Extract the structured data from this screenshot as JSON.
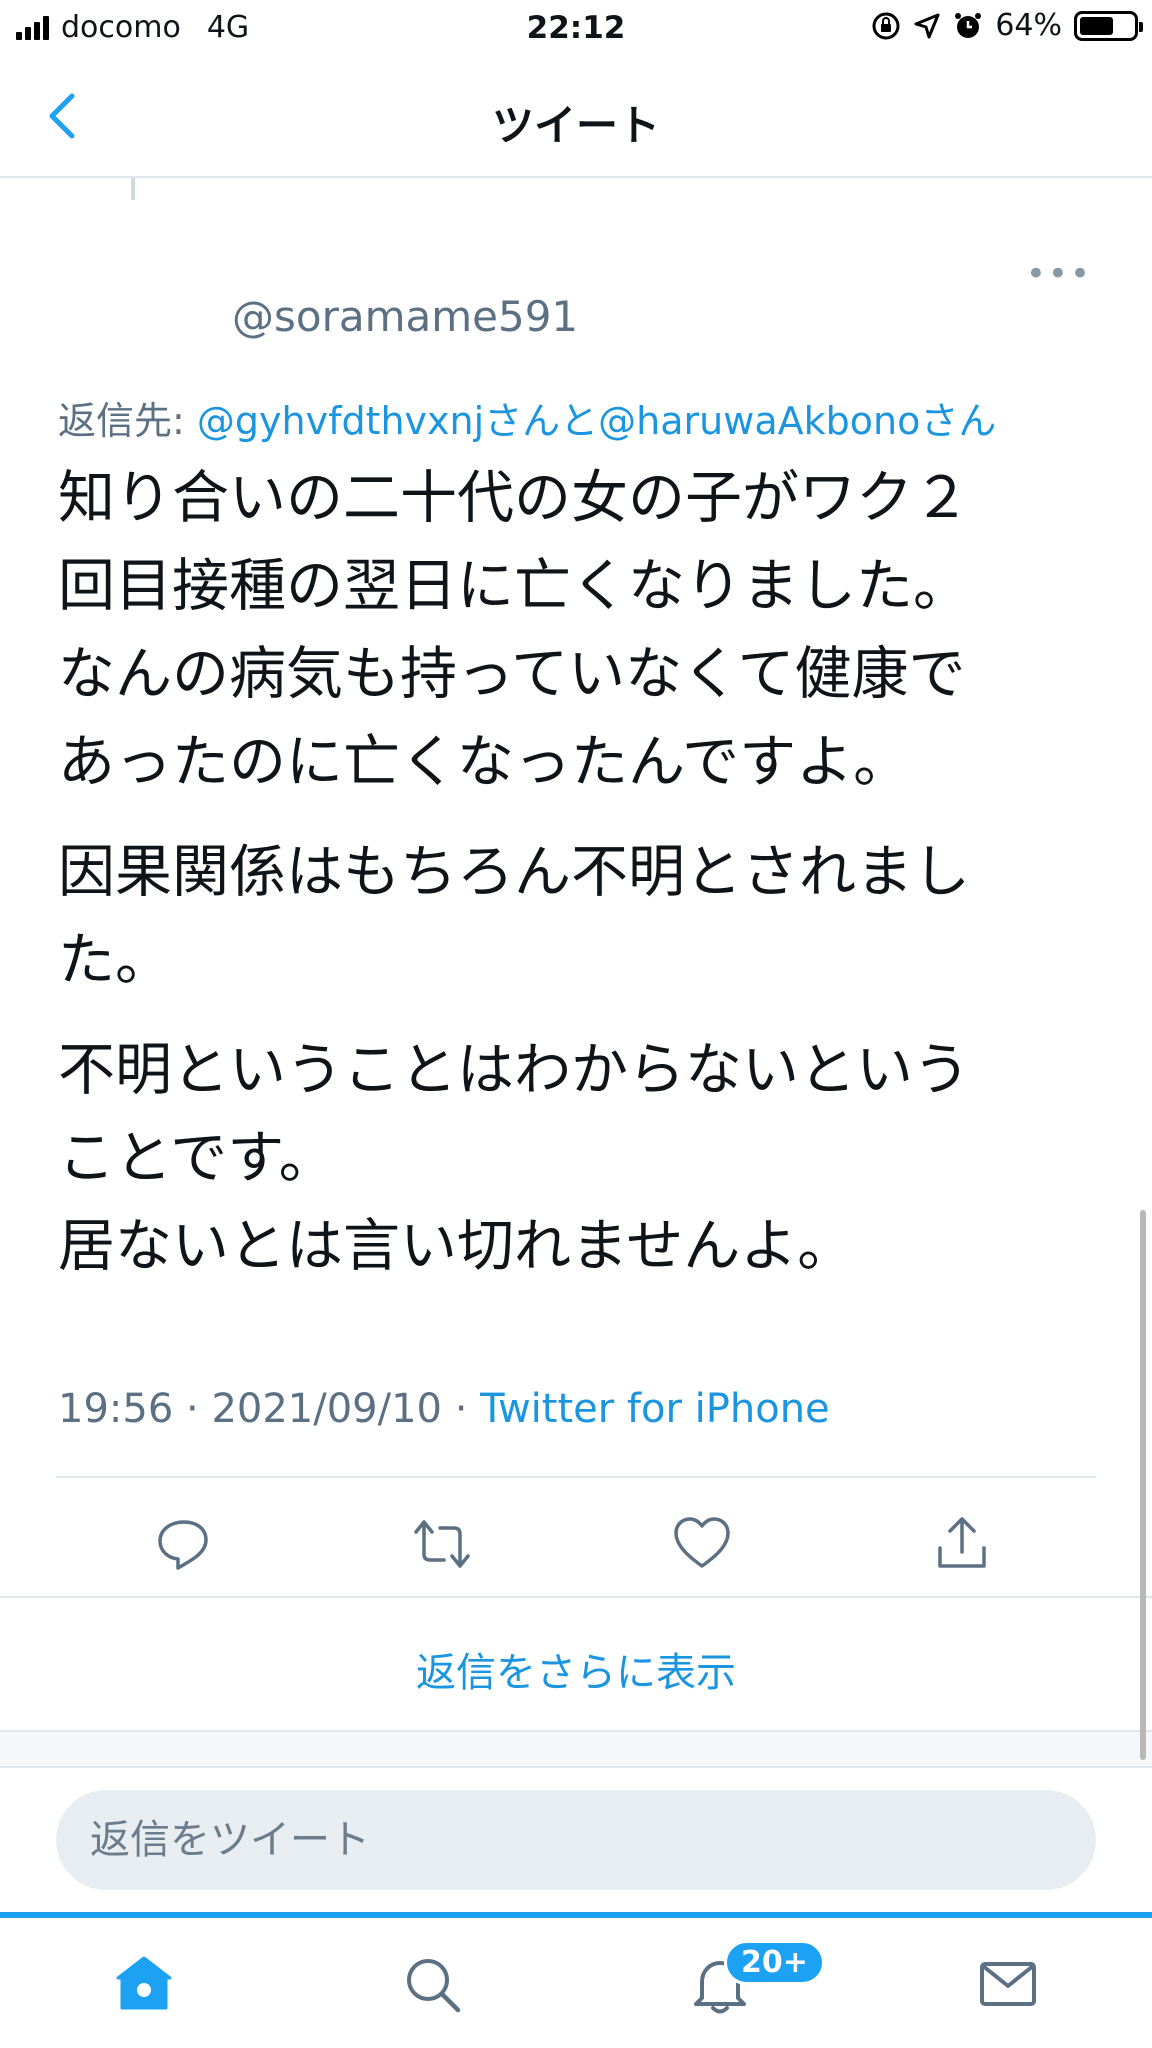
{
  "status_bar": {
    "carrier": "docomo",
    "network": "4G",
    "time": "22:12",
    "battery_percent": "64%",
    "battery_level": 0.64
  },
  "nav": {
    "title": "ツイート"
  },
  "tweet": {
    "handle": "@soramame591",
    "reply_prefix": "返信先: ",
    "reply_targets": "@gyhvfdthvxnjさんと@haruwaAkbonoさん",
    "paragraphs": [
      [
        "知り合いの二十代の女の子がワク２",
        "回目接種の翌日に亡くなりました。",
        "なんの病気も持っていなくて健康で",
        "あったのに亡くなったんですよ。"
      ],
      [
        "因果関係はもちろん不明とされまし",
        "た。"
      ],
      [
        "不明ということはわからないという",
        "ことです。",
        "居ないとは言い切れませんよ。"
      ]
    ],
    "time": "19:56",
    "date": "2021/09/10",
    "separator": " · ",
    "source": "Twitter for iPhone"
  },
  "more_replies": "返信をさらに表示",
  "reply_input": {
    "placeholder": "返信をツイート"
  },
  "tab_bar": {
    "notification_badge": "20+"
  },
  "colors": {
    "accent": "#1da1f2",
    "link": "#1b95e0",
    "secondary_text": "#5b7083"
  }
}
